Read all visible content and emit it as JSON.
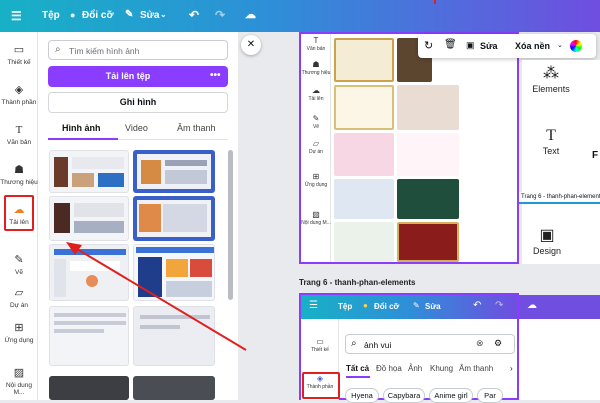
{
  "topbar": {
    "file_label": "Tệp",
    "change_label": "Đổi cỡ",
    "edit_label": "Sửa"
  },
  "rail": [
    {
      "label": "Thiết kế",
      "icon": "layout-icon"
    },
    {
      "label": "Thành phần",
      "icon": "elements-icon"
    },
    {
      "label": "Văn bản",
      "icon": "text-icon"
    },
    {
      "label": "Thương hiệu",
      "icon": "brand-icon"
    },
    {
      "label": "Tải lên",
      "icon": "cloud-upload-icon"
    },
    {
      "label": "Vẽ",
      "icon": "draw-icon"
    },
    {
      "label": "Dự án",
      "icon": "folder-icon"
    },
    {
      "label": "Ứng dụng",
      "icon": "apps-icon"
    },
    {
      "label": "Nội dung M...",
      "icon": "photos-icon"
    }
  ],
  "panel": {
    "search_placeholder": "Tìm kiếm hình ảnh",
    "upload_button": "Tải lên tệp",
    "record_button": "Ghi hình",
    "tabs": [
      "Hình ảnh",
      "Video",
      "Âm thanh"
    ]
  },
  "inner_rail": [
    "Văn bản",
    "Thương hiệu",
    "Tải lên",
    "Vẽ",
    "Dự án",
    "Ứng dụng",
    "Nội dung M..."
  ],
  "toolbar": {
    "edit_label": "Sửa",
    "bg_remove": "Xóa nền"
  },
  "elements_panel": {
    "elements": "Elements",
    "text": "Text",
    "design": "Design"
  },
  "page6": {
    "label": "Trang 6 - thanh-phan-elements",
    "file_label": "Tệp",
    "change_label": "Đổi cỡ",
    "edit_label": "Sửa",
    "search_value": "ảnh vui",
    "filters": [
      "Tất cả",
      "Đồ họa",
      "Ảnh",
      "Khung",
      "Âm thanh"
    ],
    "rail": [
      "Thiết kế",
      "Thành phần"
    ],
    "pills": [
      "Hyena",
      "Capybara",
      "Anime girl",
      "Par"
    ]
  },
  "tooltip_label": "Trang 6 - thanh-phan-elements",
  "colors": {
    "accent": "#8b3dff",
    "highlight": "#e0201e"
  }
}
